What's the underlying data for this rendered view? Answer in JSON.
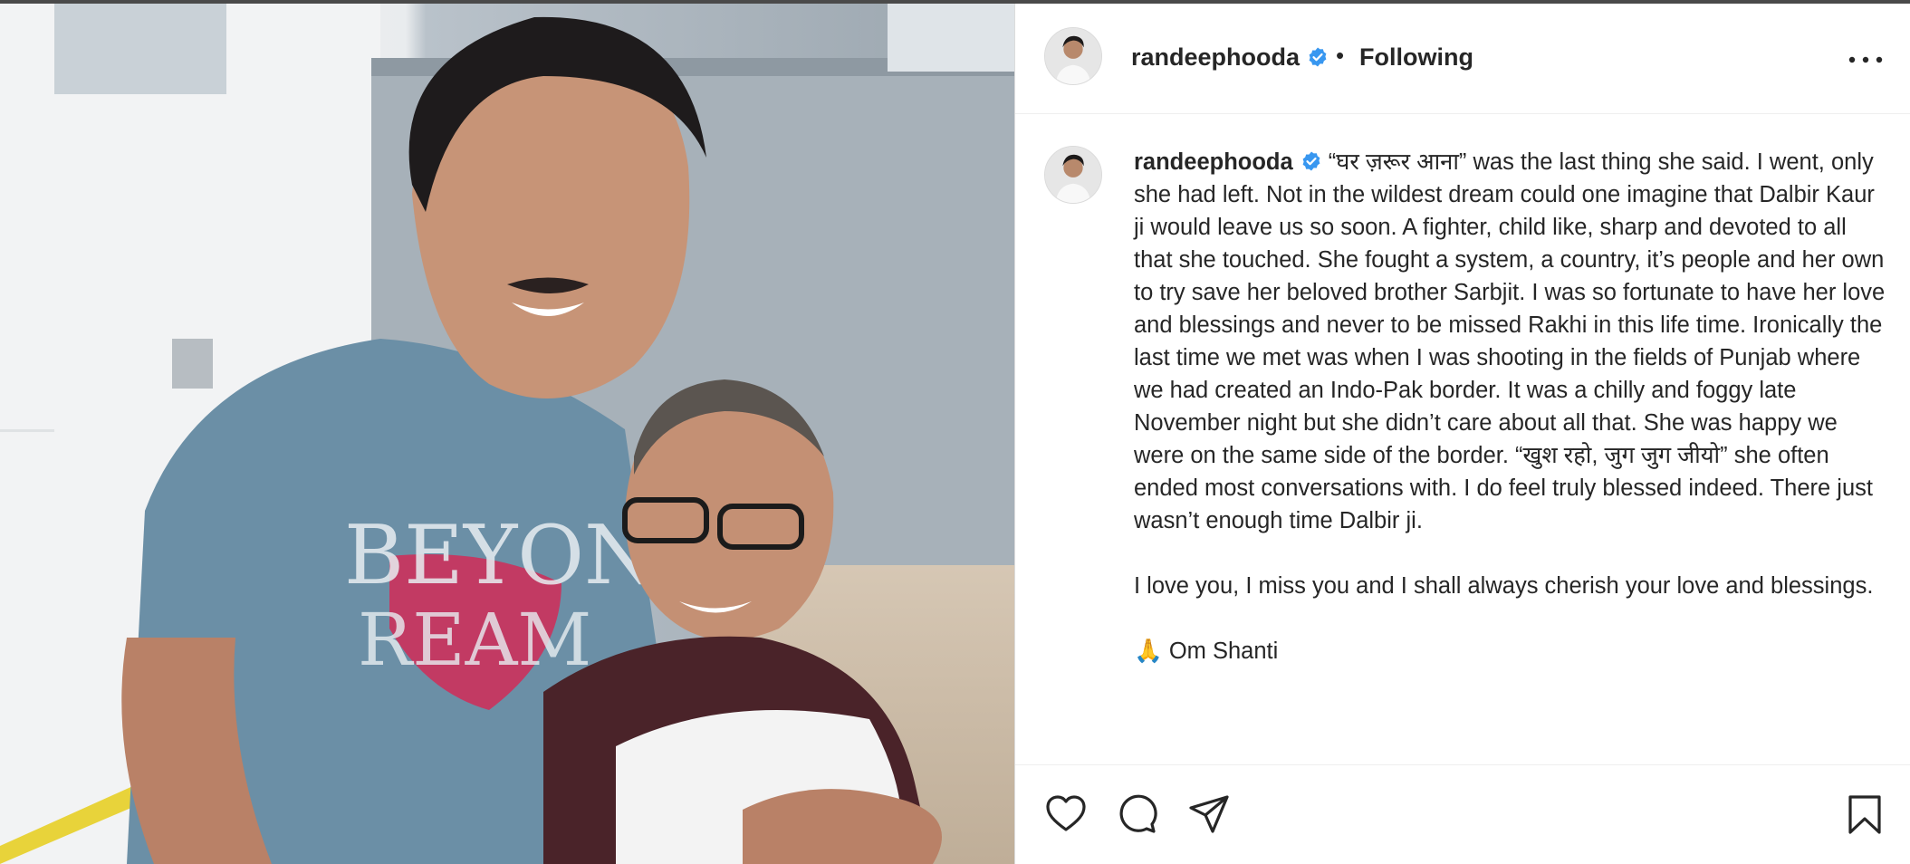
{
  "post": {
    "username": "randeephooda",
    "separator": "•",
    "follow_status": "Following",
    "caption_paragraphs": [
      "“घर ज़रूर आना” was the last thing she said. I went, only she had left. Not in the wildest dream could one imagine that Dalbir Kaur ji would leave us so soon. A fighter, child like, sharp and devoted to all that she touched. She fought a system, a country, it’s people and her own to try save her beloved brother Sarbjit. I was so fortunate to have her love and blessings and never to be missed Rakhi in this life time. Ironically the last time we met was when I was shooting in the fields of Punjab where we had created an Indo-Pak border. It was a chilly and foggy late November night but she didn’t care about all that. She was happy we were on the same side of the border. “खुश रहो, जुग जुग जीयो” she often ended most conversations with. I do feel truly blessed indeed. There just wasn’t enough time Dalbir ji.",
      "I love you, I miss you and I shall always cherish your love and blessings.",
      "🙏 Om Shanti"
    ]
  },
  "icons": {
    "verified": "verified-badge-icon",
    "more": "more-options-icon",
    "like": "heart-icon",
    "comment": "comment-icon",
    "share": "paper-plane-icon",
    "save": "bookmark-icon"
  },
  "colors": {
    "verified_blue": "#3897f0",
    "text": "#262626",
    "border": "#dbdbdb"
  }
}
